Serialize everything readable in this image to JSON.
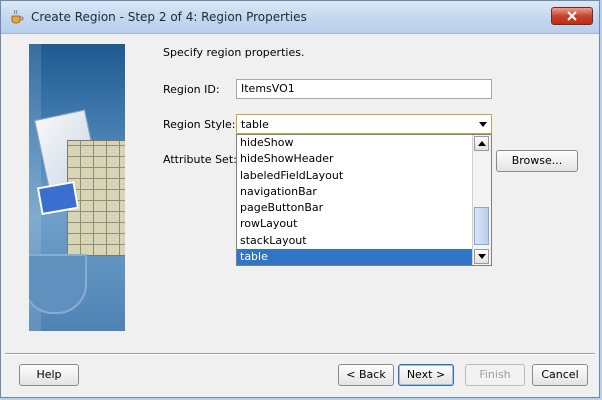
{
  "window": {
    "title": "Create Region - Step 2 of 4: Region Properties",
    "app_icon": "coffee-cup-icon",
    "close_icon": "close-icon"
  },
  "content": {
    "instruction": "Specify region properties.",
    "region_id_label": "Region ID:",
    "region_id_value": "ItemsVO1",
    "region_style_label": "Region Style:",
    "region_style_value": "table",
    "attribute_set_label": "Attribute Set:",
    "browse_label": "Browse..."
  },
  "dropdown": {
    "options": [
      "hideShow",
      "hideShowHeader",
      "labeledFieldLayout",
      "navigationBar",
      "pageButtonBar",
      "rowLayout",
      "stackLayout",
      "table"
    ],
    "selected": "table"
  },
  "footer": {
    "help_label": "Help",
    "back_label": "< Back",
    "next_label": "Next >",
    "finish_label": "Finish",
    "cancel_label": "Cancel"
  },
  "colors": {
    "selection": "#3175c6",
    "title_bar": "#c4d7ef",
    "close_button": "#c8432b"
  }
}
